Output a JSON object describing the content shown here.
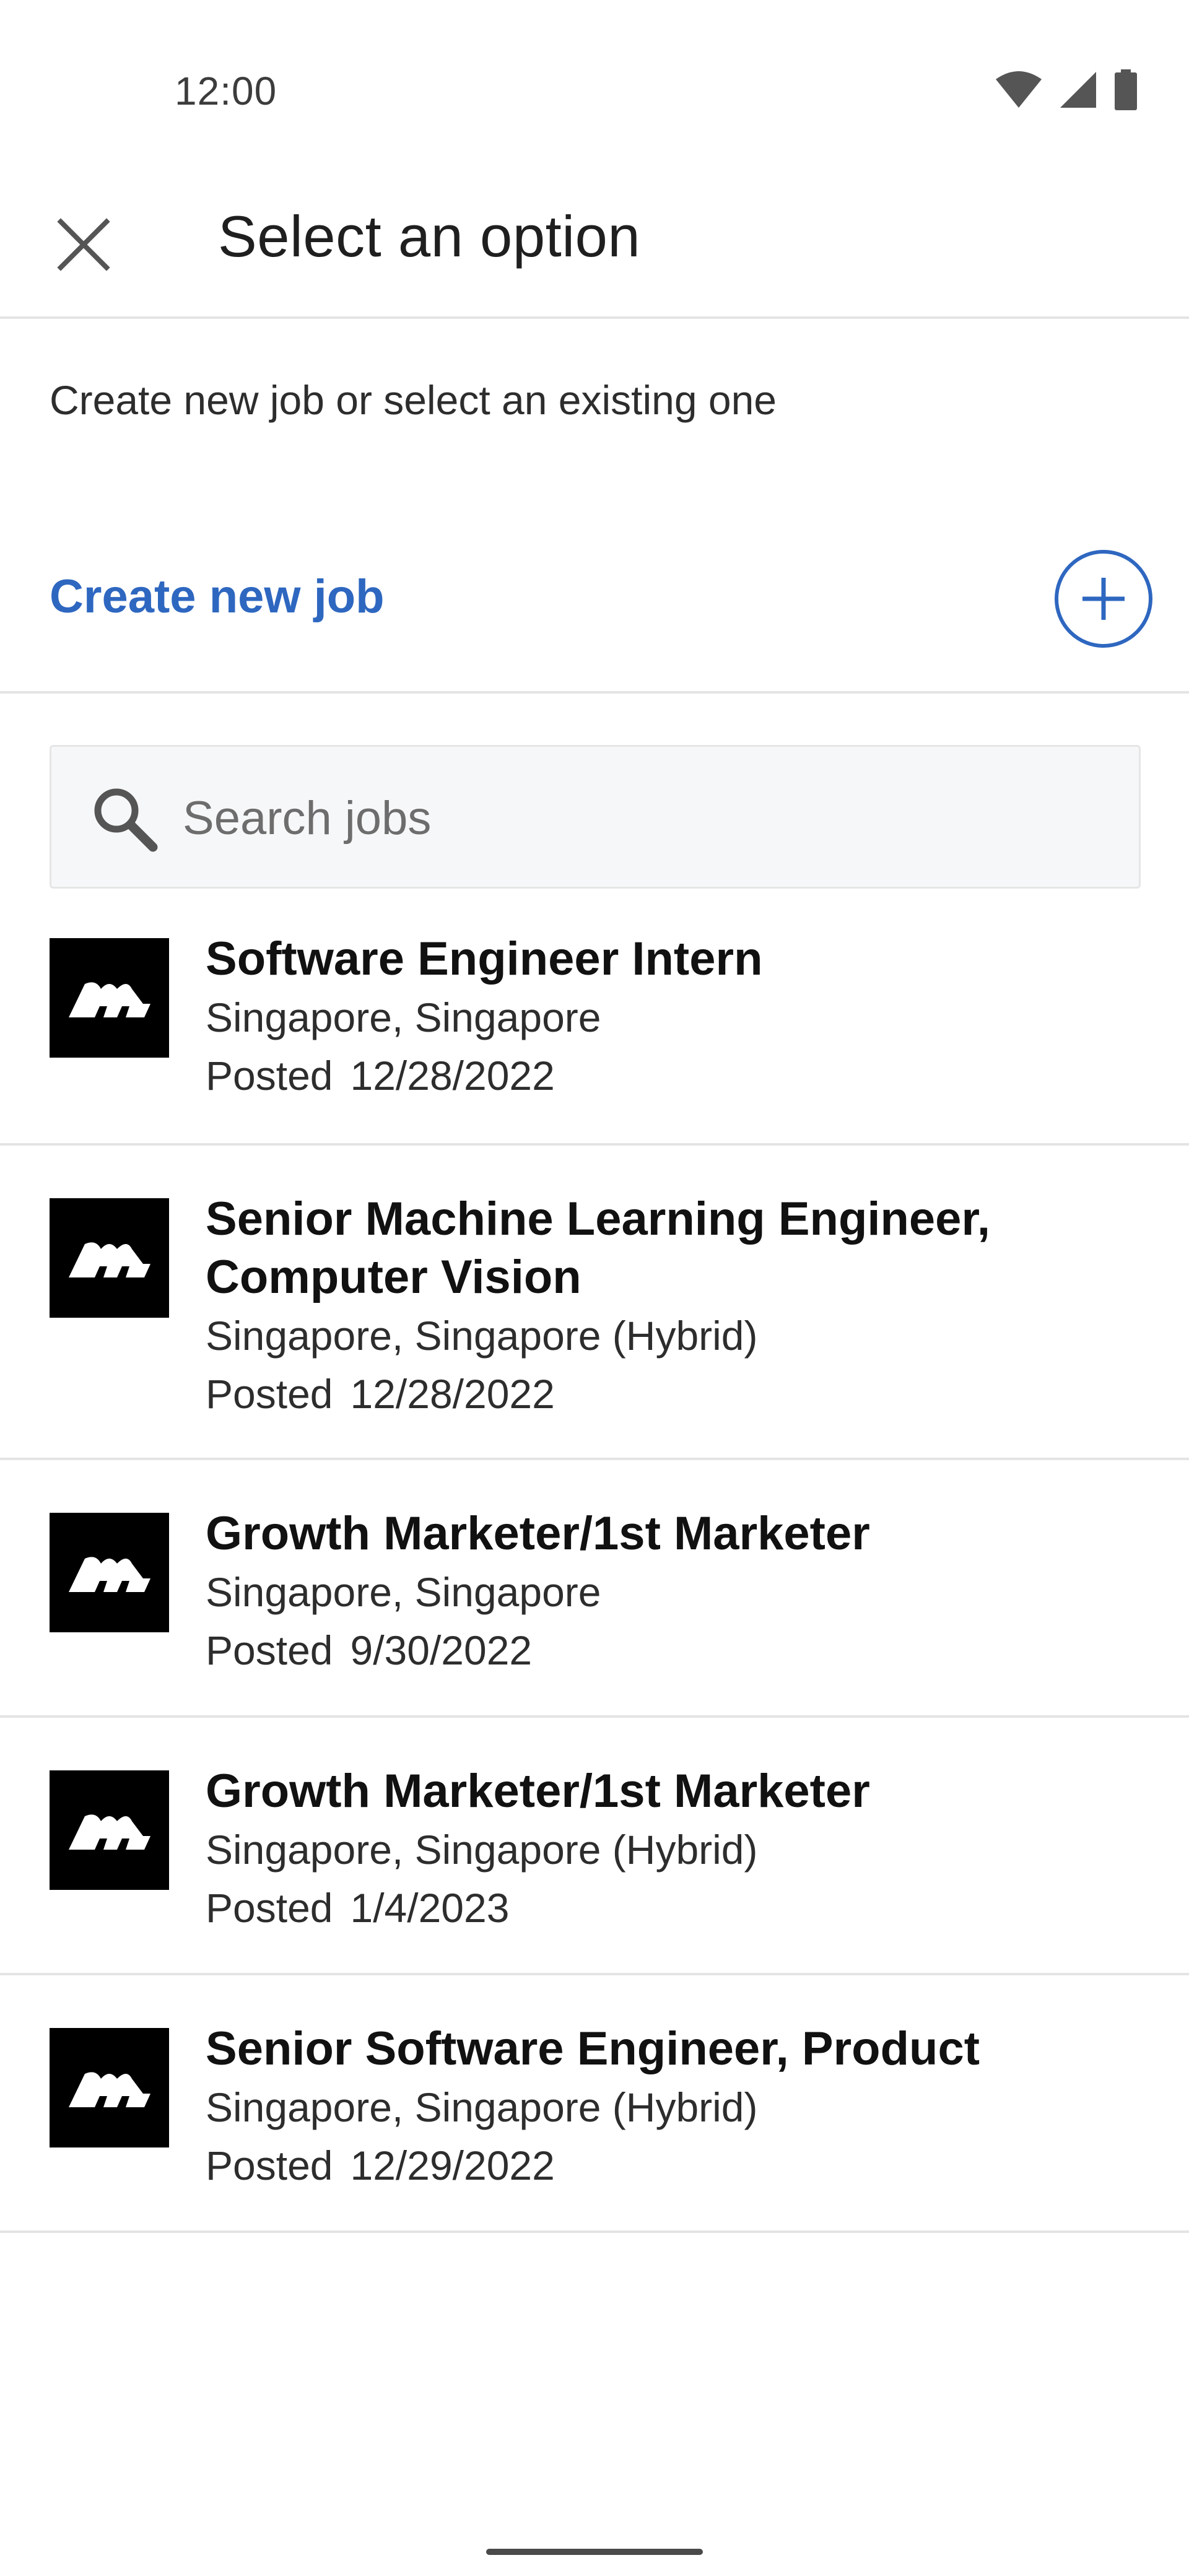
{
  "status_bar": {
    "time": "12:00",
    "icons": [
      "wifi-icon",
      "cellular-signal-icon",
      "battery-icon"
    ]
  },
  "app_bar": {
    "title": "Select an option",
    "close_icon": "close-icon"
  },
  "subtitle": "Create new job or select an existing one",
  "create": {
    "label": "Create new job",
    "icon": "plus-circle-icon",
    "color": "#2e67c0"
  },
  "search": {
    "placeholder": "Search jobs",
    "value": "",
    "icon": "search-icon"
  },
  "jobs": [
    {
      "title": "Software Engineer Intern",
      "location": "Singapore, Singapore",
      "posted_label": "Posted",
      "posted_date": "12/28/2022"
    },
    {
      "title": "Senior Machine Learning Engineer, Computer Vision",
      "location": "Singapore, Singapore (Hybrid)",
      "posted_label": "Posted",
      "posted_date": "12/28/2022"
    },
    {
      "title": "Growth Marketer/1st Marketer",
      "location": "Singapore, Singapore",
      "posted_label": "Posted",
      "posted_date": "9/30/2022"
    },
    {
      "title": "Growth Marketer/1st Marketer",
      "location": "Singapore, Singapore (Hybrid)",
      "posted_label": "Posted",
      "posted_date": "1/4/2023"
    },
    {
      "title": "Senior Software Engineer, Product",
      "location": "Singapore, Singapore (Hybrid)",
      "posted_label": "Posted",
      "posted_date": "12/29/2022"
    }
  ],
  "colors": {
    "accent": "#2e67c0",
    "divider": "#e4e4e4",
    "logo_bg": "#000000"
  }
}
